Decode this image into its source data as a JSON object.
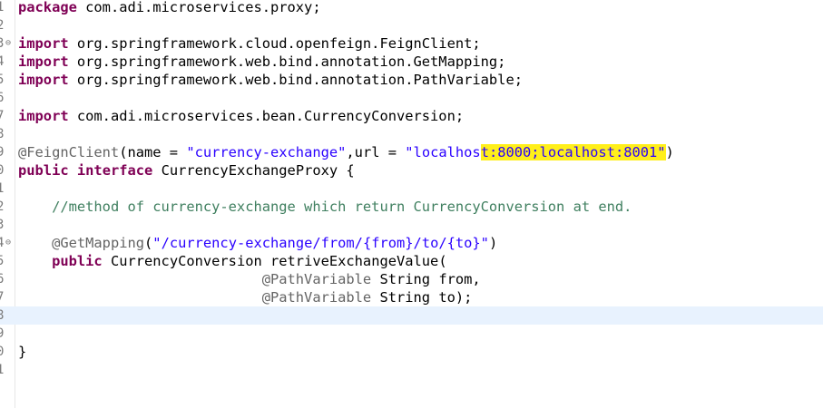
{
  "lines": [
    {
      "num": "1",
      "segs": [
        {
          "c": "kw",
          "t": "package"
        },
        {
          "c": "",
          "t": " com.adi.microservices.proxy;"
        }
      ]
    },
    {
      "num": "2",
      "segs": []
    },
    {
      "num": "3",
      "fold": "⊖",
      "segs": [
        {
          "c": "kw",
          "t": "import"
        },
        {
          "c": "",
          "t": " org.springframework.cloud.openfeign.FeignClient;"
        }
      ]
    },
    {
      "num": "4",
      "segs": [
        {
          "c": "kw",
          "t": "import"
        },
        {
          "c": "",
          "t": " org.springframework.web.bind.annotation.GetMapping;"
        }
      ]
    },
    {
      "num": "5",
      "segs": [
        {
          "c": "kw",
          "t": "import"
        },
        {
          "c": "",
          "t": " org.springframework.web.bind.annotation.PathVariable;"
        }
      ]
    },
    {
      "num": "6",
      "segs": []
    },
    {
      "num": "7",
      "segs": [
        {
          "c": "kw",
          "t": "import"
        },
        {
          "c": "",
          "t": " com.adi.microservices.bean.CurrencyConversion;"
        }
      ]
    },
    {
      "num": "8",
      "segs": []
    },
    {
      "num": "9",
      "segs": [
        {
          "c": "ann",
          "t": "@FeignClient"
        },
        {
          "c": "",
          "t": "(name = "
        },
        {
          "c": "str",
          "t": "\"currency-exchange\""
        },
        {
          "c": "",
          "t": ",url = "
        },
        {
          "c": "str",
          "t": "\"localhos"
        },
        {
          "c": "str hl",
          "t": "t:8000;localhost:8001\""
        },
        {
          "c": "",
          "t": ")"
        }
      ]
    },
    {
      "num": "0",
      "segs": [
        {
          "c": "kw",
          "t": "public"
        },
        {
          "c": "",
          "t": " "
        },
        {
          "c": "kw",
          "t": "interface"
        },
        {
          "c": "",
          "t": " CurrencyExchangeProxy {"
        }
      ]
    },
    {
      "num": "1",
      "segs": []
    },
    {
      "num": "2",
      "segs": [
        {
          "c": "",
          "t": "    "
        },
        {
          "c": "cm",
          "t": "//method of currency-exchange which return CurrencyConversion at end."
        }
      ]
    },
    {
      "num": "3",
      "segs": []
    },
    {
      "num": "4",
      "fold": "⊖",
      "segs": [
        {
          "c": "",
          "t": "    "
        },
        {
          "c": "ann",
          "t": "@GetMapping"
        },
        {
          "c": "",
          "t": "("
        },
        {
          "c": "str",
          "t": "\"/currency-exchange/from/{from}/to/{to}\""
        },
        {
          "c": "",
          "t": ")"
        }
      ]
    },
    {
      "num": "5",
      "segs": [
        {
          "c": "",
          "t": "    "
        },
        {
          "c": "kw",
          "t": "public"
        },
        {
          "c": "",
          "t": " CurrencyConversion retriveExchangeValue("
        }
      ]
    },
    {
      "num": "6",
      "segs": [
        {
          "c": "",
          "t": "                             "
        },
        {
          "c": "ann",
          "t": "@PathVariable"
        },
        {
          "c": "",
          "t": " String from,"
        }
      ]
    },
    {
      "num": "7",
      "segs": [
        {
          "c": "",
          "t": "                             "
        },
        {
          "c": "ann",
          "t": "@PathVariable"
        },
        {
          "c": "",
          "t": " String to);"
        }
      ]
    },
    {
      "num": "8",
      "current": true,
      "segs": []
    },
    {
      "num": "9",
      "segs": []
    },
    {
      "num": "0",
      "segs": [
        {
          "c": "",
          "t": "}"
        }
      ]
    },
    {
      "num": "1",
      "segs": []
    }
  ]
}
